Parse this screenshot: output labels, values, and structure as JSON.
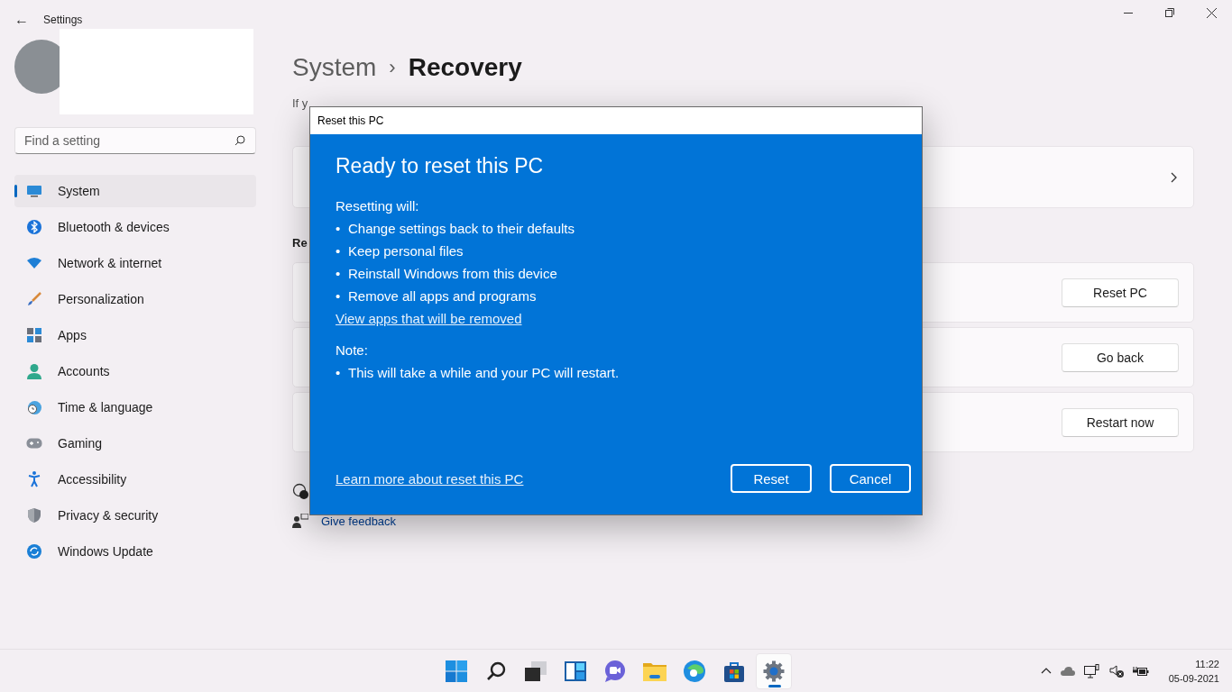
{
  "window": {
    "title": "Settings",
    "back": "←"
  },
  "search": {
    "placeholder": "Find a setting"
  },
  "sidebar": {
    "items": [
      {
        "label": "System",
        "selected": true
      },
      {
        "label": "Bluetooth & devices",
        "selected": false
      },
      {
        "label": "Network & internet",
        "selected": false
      },
      {
        "label": "Personalization",
        "selected": false
      },
      {
        "label": "Apps",
        "selected": false
      },
      {
        "label": "Accounts",
        "selected": false
      },
      {
        "label": "Time & language",
        "selected": false
      },
      {
        "label": "Gaming",
        "selected": false
      },
      {
        "label": "Accessibility",
        "selected": false
      },
      {
        "label": "Privacy & security",
        "selected": false
      },
      {
        "label": "Windows Update",
        "selected": false
      }
    ]
  },
  "breadcrumb": {
    "parent": "System",
    "separator": "›",
    "current": "Recovery"
  },
  "intro_text": "If y",
  "section_heading": "Re",
  "options": [
    {
      "kind": "link"
    },
    {
      "kind": "button",
      "button": "Reset PC"
    },
    {
      "kind": "button",
      "button": "Go back"
    },
    {
      "kind": "button",
      "button": "Restart now"
    }
  ],
  "footer_links": [
    {
      "kind": "help"
    },
    {
      "kind": "feedback",
      "label": "Give feedback"
    }
  ],
  "dialog": {
    "title": "Reset this PC",
    "heading": "Ready to reset this PC",
    "intro": "Resetting will:",
    "bullet": "•",
    "bullets": [
      "Change settings back to their defaults",
      "Keep personal files",
      "Reinstall Windows from this device",
      "Remove all apps and programs"
    ],
    "link": "View apps that will be removed",
    "note_label": "Note:",
    "note_bullets": [
      "This will take a while and your PC will restart."
    ],
    "learn_more": "Learn more about reset this PC",
    "buttons": [
      "Reset",
      "Cancel"
    ]
  },
  "taskbar": {
    "apps": [
      {
        "kind": "start",
        "selected": false
      },
      {
        "kind": "search",
        "selected": false
      },
      {
        "kind": "taskview",
        "selected": false
      },
      {
        "kind": "widgets",
        "selected": false
      },
      {
        "kind": "chat",
        "selected": false
      },
      {
        "kind": "explorer",
        "selected": false
      },
      {
        "kind": "edge",
        "selected": false
      },
      {
        "kind": "store",
        "selected": false
      },
      {
        "kind": "settings",
        "selected": true
      }
    ],
    "time": "11:22",
    "date": "05-09-2021"
  }
}
